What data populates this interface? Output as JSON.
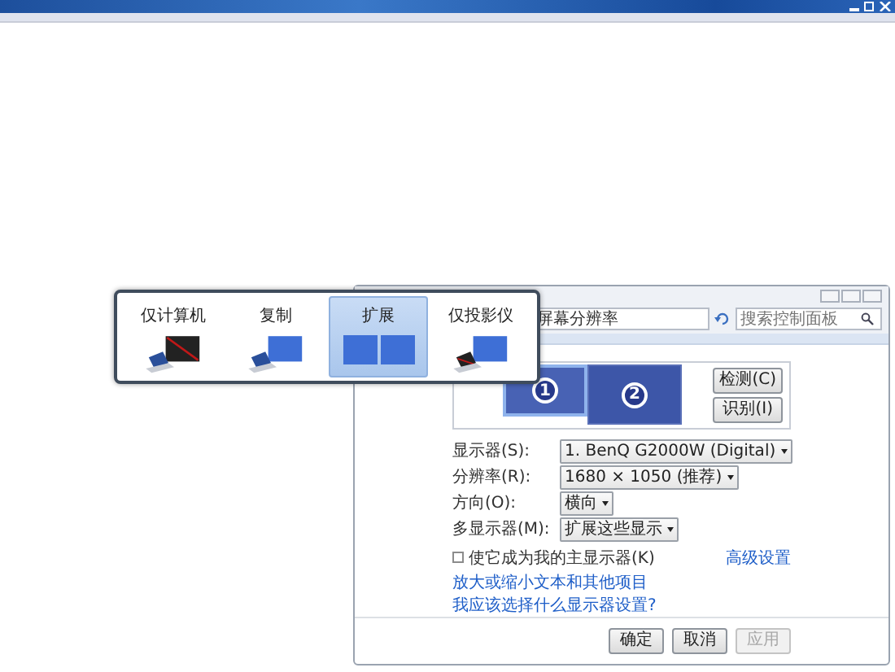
{
  "popup": {
    "items": [
      {
        "kind": "pc_only",
        "label": "仅计算机",
        "selected": false
      },
      {
        "kind": "duplicate",
        "label": "复制",
        "selected": false
      },
      {
        "kind": "extend",
        "label": "扩展",
        "selected": true
      },
      {
        "kind": "projector_only",
        "label": "仅投影仪",
        "selected": false
      }
    ]
  },
  "window": {
    "breadcrumb": "屏幕分辨率",
    "search": {
      "placeholder": "搜索控制面板"
    },
    "monitors": [
      {
        "number": "1",
        "selected": true
      },
      {
        "number": "2",
        "selected": false
      }
    ],
    "side_buttons": [
      "检测(C)",
      "识别(I)"
    ],
    "settings": [
      {
        "label": "显示器(S):",
        "value": "1. BenQ G2000W (Digital)"
      },
      {
        "label": "分辨率(R):",
        "value": "1680 × 1050 (推荐)"
      },
      {
        "label": "方向(O):",
        "value": "横向"
      },
      {
        "label": "多显示器(M):",
        "value": "扩展这些显示"
      }
    ],
    "primary_checkbox": {
      "label": "使它成为我的主显示器(K)",
      "checked": false
    },
    "advanced_link": "高级设置",
    "links": [
      "放大或缩小文本和其他项目",
      "我应该选择什么显示器设置?"
    ],
    "buttons": [
      {
        "label": "确定",
        "disabled": false
      },
      {
        "label": "取消",
        "disabled": false
      },
      {
        "label": "应用",
        "disabled": true
      }
    ]
  }
}
